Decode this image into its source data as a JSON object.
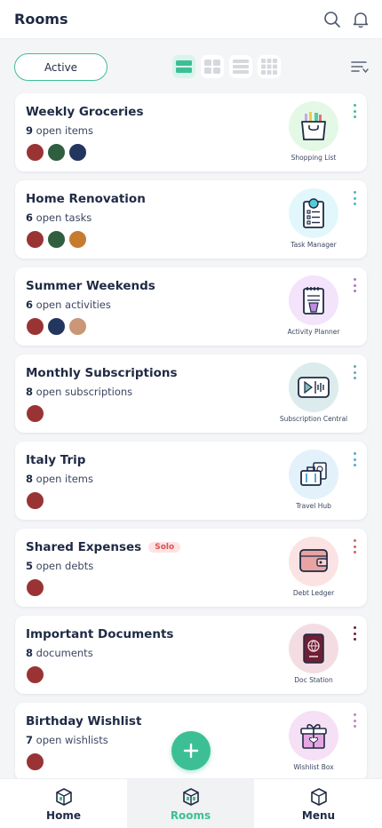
{
  "header": {
    "title": "Rooms"
  },
  "toolbar": {
    "filter_label": "Active"
  },
  "rooms": [
    {
      "title": "Weekly Groceries",
      "count": "9",
      "count_suffix": " open items",
      "app": "Shopping List",
      "badge": "",
      "members": 3
    },
    {
      "title": "Home Renovation",
      "count": "6",
      "count_suffix": " open tasks",
      "app": "Task Manager",
      "badge": "",
      "members": 3
    },
    {
      "title": "Summer Weekends",
      "count": "6",
      "count_suffix": " open activities",
      "app": "Activity Planner",
      "badge": "",
      "members": 3
    },
    {
      "title": "Monthly Subscriptions",
      "count": "8",
      "count_suffix": " open subscriptions",
      "app": "Subscription Central",
      "badge": "",
      "members": 1
    },
    {
      "title": "Italy Trip",
      "count": "8",
      "count_suffix": " open items",
      "app": "Travel Hub",
      "badge": "",
      "members": 1
    },
    {
      "title": "Shared Expenses",
      "count": "5",
      "count_suffix": " open debts",
      "app": "Debt Ledger",
      "badge": "Solo",
      "members": 1
    },
    {
      "title": "Important Documents",
      "count": "8",
      "count_suffix": " documents",
      "app": "Doc Station",
      "badge": "",
      "members": 1
    },
    {
      "title": "Birthday Wishlist",
      "count": "7",
      "count_suffix": " open wishlists",
      "app": "Wishlist Box",
      "badge": "",
      "members": 1
    }
  ],
  "bottom_nav": {
    "home": "Home",
    "rooms": "Rooms",
    "menu": "Menu"
  },
  "colors": {
    "accent": "#3dbf95",
    "text": "#1f2a44",
    "badge_bg": "#fde3e3",
    "badge_text": "#d9534f",
    "shopping": "#e4f8e6",
    "tasks": "#e2f7fb",
    "activity": "#f3e3fb",
    "subscription": "#dcecec",
    "travel": "#e3f1fb",
    "debt": "#fbe3e3",
    "docs": "#f3dde3",
    "wishlist": "#f6e0f6"
  },
  "icons": [
    "search-icon",
    "bell-icon",
    "sort-icon",
    "shopping-bag-icon",
    "clipboard-icon",
    "notepad-icon",
    "video-icon",
    "luggage-icon",
    "wallet-icon",
    "passport-icon",
    "gift-icon",
    "plus-icon",
    "home-cube-icon",
    "rooms-cube-icon",
    "menu-cube-icon"
  ]
}
